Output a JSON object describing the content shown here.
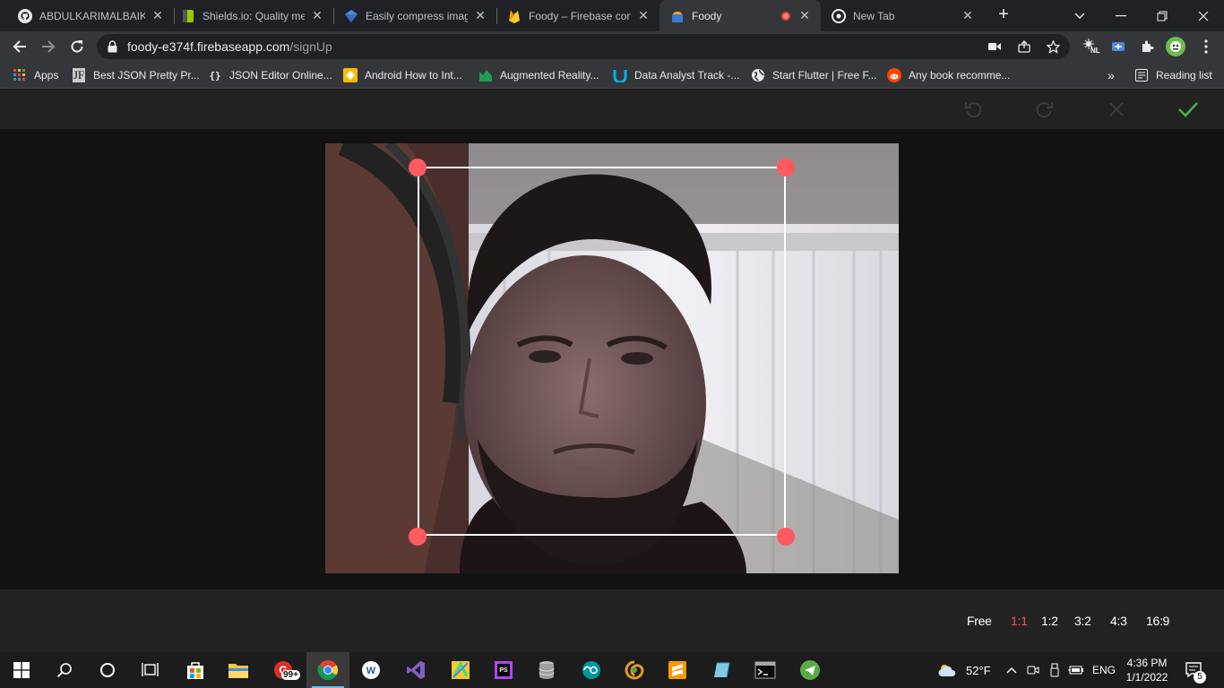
{
  "browser": {
    "tabs": [
      {
        "title": "ABDULKARIMALBAIK/",
        "icon": "github-icon"
      },
      {
        "title": "Shields.io: Quality met",
        "icon": "shields-icon"
      },
      {
        "title": "Easily compress image",
        "icon": "compress-icon"
      },
      {
        "title": "Foody – Firebase cons",
        "icon": "firebase-icon"
      },
      {
        "title": "Foody",
        "icon": "foody-icon",
        "active": true,
        "recording": true
      },
      {
        "title": "New Tab",
        "icon": "chrome-icon"
      }
    ],
    "url_host": "foody-e374f.firebaseapp.com",
    "url_path": "/signUp",
    "extension_badge": "NL",
    "bookmarks": [
      {
        "label": "Apps",
        "icon": "apps-grid-icon"
      },
      {
        "label": "Best JSON Pretty Pr...",
        "icon_text": "JF"
      },
      {
        "label": "JSON Editor Online...",
        "icon_text": "{}"
      },
      {
        "label": "Android How to Int...",
        "icon_text": "A"
      },
      {
        "label": "Augmented Reality...",
        "icon_text": "AR"
      },
      {
        "label": "Data Analyst Track -...",
        "icon_text": "U"
      },
      {
        "label": "Start Flutter | Free F...",
        "icon_text": "S"
      },
      {
        "label": "Any book recomme...",
        "icon_text": "R"
      }
    ],
    "reading_list": "Reading list",
    "overflow": "»"
  },
  "cropper": {
    "ratios": [
      {
        "label": "Free",
        "active": false
      },
      {
        "label": "1:1",
        "active": true
      },
      {
        "label": "1:2",
        "active": false
      },
      {
        "label": "3:2",
        "active": false
      },
      {
        "label": "4:3",
        "active": false
      },
      {
        "label": "16:9",
        "active": false
      }
    ],
    "accent_color": "#ff5a5f",
    "confirm_color": "#4caf50"
  },
  "taskbar": {
    "weather": "52°F",
    "language": "ENG",
    "time": "4:36 PM",
    "date": "1/1/2022",
    "mail_badge": "99+",
    "notification_count": "5"
  }
}
